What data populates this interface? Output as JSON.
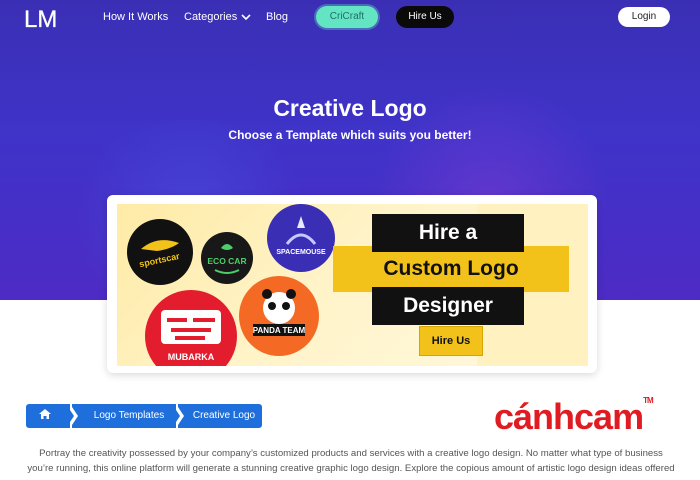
{
  "nav": {
    "brand": "LM",
    "how_it_works": "How It Works",
    "categories": "Categories",
    "blog": "Blog",
    "cricraft": "CriCraft",
    "hire_us": "Hire Us",
    "login": "Login"
  },
  "hero": {
    "title": "Creative Logo",
    "subtitle": "Choose a Template which suits you better!"
  },
  "banner": {
    "line1": "Hire a",
    "line2": "Custom Logo",
    "line3": "Designer",
    "button": "Hire Us",
    "logos": {
      "sports": "sportscar",
      "eco": "ECO CAR",
      "space": "SPACEMOUSE",
      "mubarka": "MUBARKA",
      "panda": "PANDA TEAM"
    }
  },
  "breadcrumb": {
    "templates": "Logo Templates",
    "current": "Creative Logo"
  },
  "watermark": "cánhcam",
  "watermark_tm": "TM",
  "description": "Portray the creativity possessed by your company’s customized products and services with a creative logo design. No matter what type of business you’re running, this online platform will generate a stunning creative graphic logo design. Explore the copious amount of artistic logo design ideas offered on our",
  "colors": {
    "hero": "#3f33c9",
    "accent_blue": "#1e6fdc",
    "cricraft": "#63e4c3",
    "banner_yellow": "#f3c21a",
    "watermark_red": "#e01b22"
  },
  "icons": [
    "home-icon",
    "chevron-down-icon"
  ]
}
